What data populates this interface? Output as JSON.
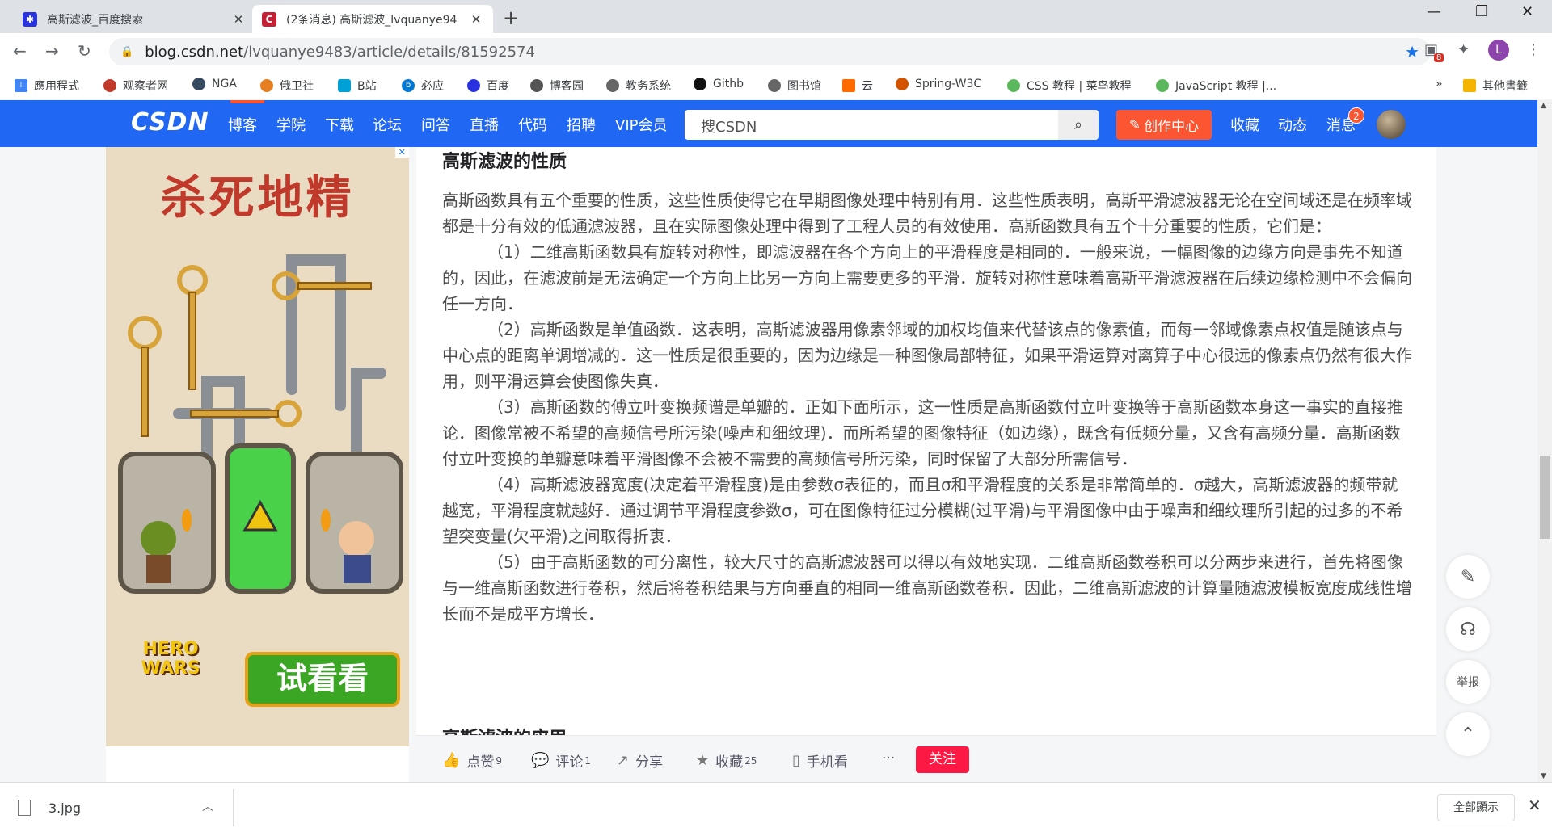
{
  "browser": {
    "tabs": [
      {
        "title": "高斯滤波_百度搜索",
        "active": false
      },
      {
        "title": "(2条消息) 高斯滤波_lvquanye94",
        "active": true
      }
    ],
    "url_host": "blog.csdn.net",
    "url_path": "/lvquanye9483/article/details/81592574",
    "profile_initial": "L",
    "ext_badge": "8",
    "bookmarks": [
      "應用程式",
      "观察者网",
      "NGA",
      "俄卫社",
      "B站",
      "必应",
      "百度",
      "博客园",
      "教务系统",
      "Githb",
      "图书馆",
      "云",
      "Spring-W3C",
      "CSS 教程 | 菜鸟教程",
      "JavaScript 教程 |..."
    ],
    "bookmarks_more": "»",
    "other_bookmarks": "其他書籤"
  },
  "csdn": {
    "logo": "CSDN",
    "nav": [
      "博客",
      "学院",
      "下载",
      "论坛",
      "问答",
      "直播",
      "代码",
      "招聘",
      "VIP会员"
    ],
    "search_placeholder": "搜CSDN",
    "create_label": "创作中心",
    "right_nav": [
      "收藏",
      "动态",
      "消息"
    ],
    "message_badge": "2"
  },
  "ad": {
    "headline": "杀死地精",
    "cta": "试看看",
    "brand_line1": "HERO",
    "brand_line2": "WARS"
  },
  "article": {
    "section_title": "高斯滤波的性质",
    "paragraphs": [
      "高斯函数具有五个重要的性质，这些性质使得它在早期图像处理中特别有用．这些性质表明，高斯平滑滤波器无论在空间域还是在频率域都是十分有效的低通滤波器，且在实际图像处理中得到了工程人员的有效使用．高斯函数具有五个十分重要的性质，它们是：",
      "（1）二维高斯函数具有旋转对称性，即滤波器在各个方向上的平滑程度是相同的．一般来说，一幅图像的边缘方向是事先不知道的，因此，在滤波前是无法确定一个方向上比另一方向上需要更多的平滑．旋转对称性意味着高斯平滑滤波器在后续边缘检测中不会偏向任一方向．",
      "（2）高斯函数是单值函数．这表明，高斯滤波器用像素邻域的加权均值来代替该点的像素值，而每一邻域像素点权值是随该点与中心点的距离单调增减的．这一性质是很重要的，因为边缘是一种图像局部特征，如果平滑运算对离算子中心很远的像素点仍然有很大作用，则平滑运算会使图像失真．",
      "（3）高斯函数的傅立叶变换频谱是单瓣的．正如下面所示，这一性质是高斯函数付立叶变换等于高斯函数本身这一事实的直接推论．图像常被不希望的高频信号所污染(噪声和细纹理)．而所希望的图像特征（如边缘），既含有低频分量，又含有高频分量．高斯函数付立叶变换的单瓣意味着平滑图像不会被不需要的高频信号所污染，同时保留了大部分所需信号．",
      "（4）高斯滤波器宽度(决定着平滑程度)是由参数σ表征的，而且σ和平滑程度的关系是非常简单的．σ越大，高斯滤波器的频带就越宽，平滑程度就越好．通过调节平滑程度参数σ，可在图像特征过分模糊(过平滑)与平滑图像中由于噪声和细纹理所引起的过多的不希望突变量(欠平滑)之间取得折衷．",
      "（5）由于高斯函数的可分离性，较大尺寸的高斯滤波器可以得以有效地实现．二维高斯函数卷积可以分两步来进行，首先将图像与一维高斯函数进行卷积，然后将卷积结果与方向垂直的相同一维高斯函数卷积．因此，二维高斯滤波的计算量随滤波模板宽度成线性增长而不是成平方增长．"
    ],
    "next_section_title": "高斯滤波的应用"
  },
  "actions": {
    "like_label": "点赞",
    "like_count": "9",
    "comment_label": "评论",
    "comment_count": "1",
    "share_label": "分享",
    "collect_label": "收藏",
    "collect_count": "25",
    "mobile_label": "手机看",
    "more": "···",
    "follow_label": "关注"
  },
  "side": {
    "report_label": "举报"
  },
  "downloads": {
    "file_name": "3.jpg",
    "show_all": "全部顯示"
  },
  "colors": {
    "csdn_blue": "#2067f3",
    "csdn_red": "#fc5531",
    "follow_red": "#fc1944"
  }
}
